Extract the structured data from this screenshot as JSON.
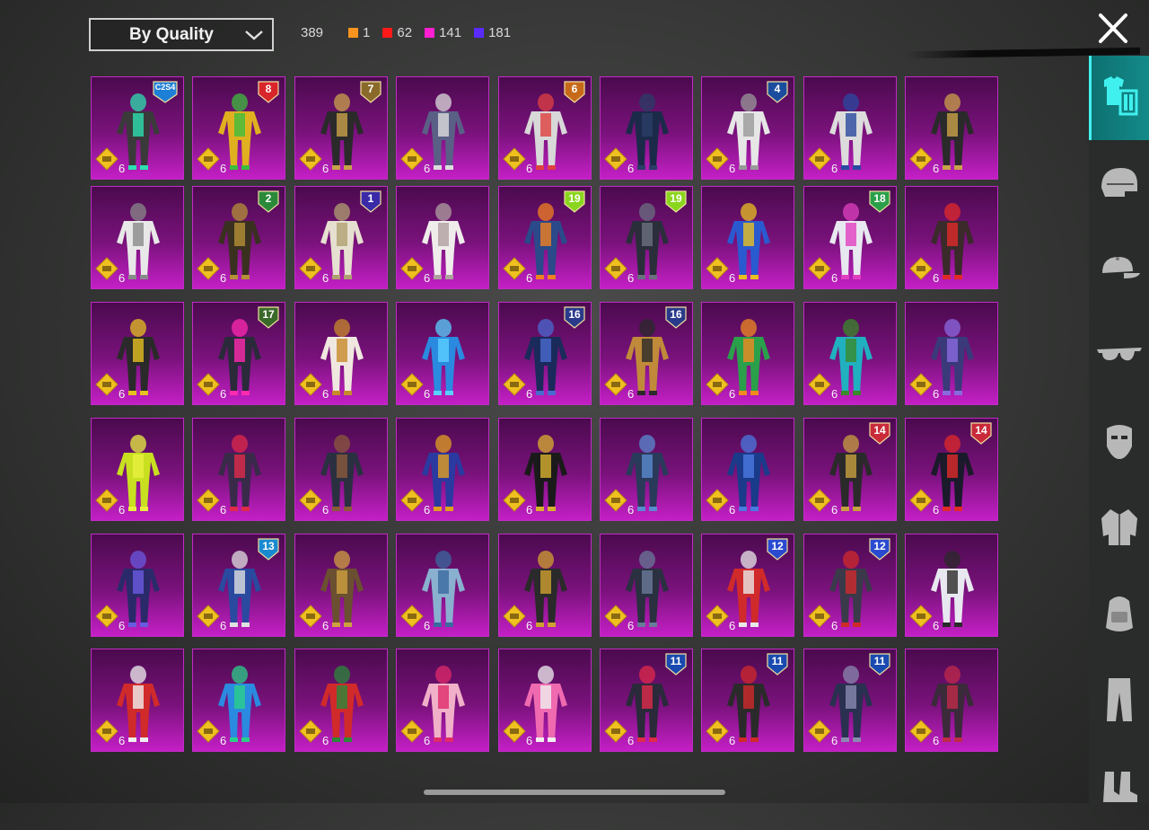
{
  "sort_dropdown": {
    "label": "By Quality"
  },
  "stats": {
    "total": "389",
    "counts": [
      {
        "value": "1",
        "color": "#f7931e"
      },
      {
        "value": "62",
        "color": "#ff1a1a"
      },
      {
        "value": "141",
        "color": "#ff1fd0"
      },
      {
        "value": "181",
        "color": "#5a2bff"
      }
    ]
  },
  "sidebar": {
    "categories": [
      {
        "icon": "outfit-icon",
        "active": true
      },
      {
        "icon": "helmet-icon",
        "active": false
      },
      {
        "icon": "cap-icon",
        "active": false
      },
      {
        "icon": "glasses-icon",
        "active": false
      },
      {
        "icon": "mask-icon",
        "active": false
      },
      {
        "icon": "jacket-icon",
        "active": false
      },
      {
        "icon": "backpack-icon",
        "active": false
      },
      {
        "icon": "pants-icon",
        "active": false
      },
      {
        "icon": "shoes-icon",
        "active": false
      }
    ]
  },
  "items": [
    {
      "qty": "6",
      "badge": "C2S4",
      "badge_color": "#1e7fd6",
      "suit": "#3a3a3a",
      "accent": "#2de0b0"
    },
    {
      "qty": "6",
      "badge": "8",
      "badge_color": "#d8252a",
      "suit": "#e0b020",
      "accent": "#3dbd3d"
    },
    {
      "qty": "6",
      "badge": "7",
      "badge_color": "#8a6a2a",
      "suit": "#2a2a2a",
      "accent": "#c9a14a"
    },
    {
      "qty": "6",
      "badge": "",
      "badge_color": "",
      "suit": "#5a5f86",
      "accent": "#dcdcdc"
    },
    {
      "qty": "6",
      "badge": "6",
      "badge_color": "#c66a1a",
      "suit": "#d8d8d8",
      "accent": "#e04040"
    },
    {
      "qty": "6",
      "badge": "",
      "badge_color": "",
      "suit": "#1c2a4a",
      "accent": "#2a3d66"
    },
    {
      "qty": "6",
      "badge": "4",
      "badge_color": "#1b4d9e",
      "suit": "#e6e6e6",
      "accent": "#9a9a9a"
    },
    {
      "qty": "6",
      "badge": "",
      "badge_color": "",
      "suit": "#dcdcdc",
      "accent": "#2a4aa0"
    },
    {
      "qty": "6",
      "badge": "",
      "badge_color": "",
      "suit": "#2a2a2a",
      "accent": "#caa24a"
    },
    {
      "qty": "6",
      "badge": "",
      "badge_color": "",
      "suit": "#e8e8e8",
      "accent": "#8a8a8a"
    },
    {
      "qty": "6",
      "badge": "2",
      "badge_color": "#2a8a3a",
      "suit": "#3a3020",
      "accent": "#b49036"
    },
    {
      "qty": "6",
      "badge": "1",
      "badge_color": "#3a2aa8",
      "suit": "#e6e0d0",
      "accent": "#b0a070"
    },
    {
      "qty": "6",
      "badge": "",
      "badge_color": "",
      "suit": "#f0ecec",
      "accent": "#b0a0a0"
    },
    {
      "qty": "6",
      "badge": "19",
      "badge_color": "#8ad61e",
      "suit": "#2a4a8a",
      "accent": "#f08020"
    },
    {
      "qty": "6",
      "badge": "19",
      "badge_color": "#8ad61e",
      "suit": "#2a2e3a",
      "accent": "#6a7080"
    },
    {
      "qty": "6",
      "badge": "",
      "badge_color": "",
      "suit": "#2a5ad0",
      "accent": "#e8c020"
    },
    {
      "qty": "6",
      "badge": "18",
      "badge_color": "#2aa04a",
      "suit": "#e8e8f0",
      "accent": "#e040c0"
    },
    {
      "qty": "6",
      "badge": "",
      "badge_color": "",
      "suit": "#3a2a2a",
      "accent": "#e02a2a"
    },
    {
      "qty": "6",
      "badge": "",
      "badge_color": "",
      "suit": "#2a2a2a",
      "accent": "#e6c020"
    },
    {
      "qty": "6",
      "badge": "17",
      "badge_color": "#3a6a2a",
      "suit": "#2a2a3a",
      "accent": "#ff2ab0"
    },
    {
      "qty": "6",
      "badge": "",
      "badge_color": "",
      "suit": "#f0e8e0",
      "accent": "#c88a2a"
    },
    {
      "qty": "6",
      "badge": "",
      "badge_color": "",
      "suit": "#2a8ae0",
      "accent": "#5ad0ff"
    },
    {
      "qty": "6",
      "badge": "16",
      "badge_color": "#2a3a8a",
      "suit": "#1a2a5a",
      "accent": "#4a6ad0"
    },
    {
      "qty": "6",
      "badge": "16",
      "badge_color": "#2a3a8a",
      "suit": "#c08a3a",
      "accent": "#2a2a2a"
    },
    {
      "qty": "6",
      "badge": "",
      "badge_color": "",
      "suit": "#2aa04a",
      "accent": "#f08a20"
    },
    {
      "qty": "6",
      "badge": "",
      "badge_color": "",
      "suit": "#20b0c0",
      "accent": "#3a8a2a"
    },
    {
      "qty": "6",
      "badge": "",
      "badge_color": "",
      "suit": "#3a3a7a",
      "accent": "#8a6ae0"
    },
    {
      "qty": "6",
      "badge": "",
      "badge_color": "",
      "suit": "#c8e020",
      "accent": "#e8f040"
    },
    {
      "qty": "6",
      "badge": "",
      "badge_color": "",
      "suit": "#3a2a4a",
      "accent": "#e02a4a"
    },
    {
      "qty": "6",
      "badge": "",
      "badge_color": "",
      "suit": "#2a3040",
      "accent": "#8a5a3a"
    },
    {
      "qty": "6",
      "badge": "",
      "badge_color": "",
      "suit": "#2a3aa0",
      "accent": "#e0a020"
    },
    {
      "qty": "6",
      "badge": "",
      "badge_color": "",
      "suit": "#1a1a1a",
      "accent": "#d8b030"
    },
    {
      "qty": "6",
      "badge": "",
      "badge_color": "",
      "suit": "#2a3a5a",
      "accent": "#5a8ad0"
    },
    {
      "qty": "6",
      "badge": "",
      "badge_color": "",
      "suit": "#1a3a8a",
      "accent": "#4a7ae0"
    },
    {
      "qty": "6",
      "badge": "14",
      "badge_color": "#c82a3a",
      "suit": "#2a2a2a",
      "accent": "#c8a040"
    },
    {
      "qty": "6",
      "badge": "14",
      "badge_color": "#c82a3a",
      "suit": "#1a1a2a",
      "accent": "#e02a2a"
    },
    {
      "qty": "6",
      "badge": "",
      "badge_color": "",
      "suit": "#2a2a6a",
      "accent": "#6a5ae0"
    },
    {
      "qty": "6",
      "badge": "13",
      "badge_color": "#1a8ad0",
      "suit": "#2a4aa0",
      "accent": "#e0e0e0"
    },
    {
      "qty": "6",
      "badge": "",
      "badge_color": "",
      "suit": "#6a5030",
      "accent": "#d0a040"
    },
    {
      "qty": "6",
      "badge": "",
      "badge_color": "",
      "suit": "#8ab0d0",
      "accent": "#3a6aa0"
    },
    {
      "qty": "6",
      "badge": "",
      "badge_color": "",
      "suit": "#2a2a2a",
      "accent": "#d0a030"
    },
    {
      "qty": "6",
      "badge": "",
      "badge_color": "",
      "suit": "#2a3040",
      "accent": "#6a7a9a"
    },
    {
      "qty": "6",
      "badge": "12",
      "badge_color": "#2a4ad0",
      "suit": "#d02a2a",
      "accent": "#e8e8e8"
    },
    {
      "qty": "6",
      "badge": "12",
      "badge_color": "#2a4ad0",
      "suit": "#3a3a4a",
      "accent": "#d02a2a"
    },
    {
      "qty": "6",
      "badge": "",
      "badge_color": "",
      "suit": "#e8e8f0",
      "accent": "#2a2a2a"
    },
    {
      "qty": "6",
      "badge": "",
      "badge_color": "",
      "suit": "#d02a2a",
      "accent": "#f0f0f0"
    },
    {
      "qty": "6",
      "badge": "",
      "badge_color": "",
      "suit": "#2a8ae0",
      "accent": "#2ad08a"
    },
    {
      "qty": "6",
      "badge": "",
      "badge_color": "",
      "suit": "#d02a2a",
      "accent": "#2a8a3a"
    },
    {
      "qty": "6",
      "badge": "",
      "badge_color": "",
      "suit": "#f0b0c8",
      "accent": "#e02a6a"
    },
    {
      "qty": "6",
      "badge": "",
      "badge_color": "",
      "suit": "#f06ab0",
      "accent": "#f0f0f0"
    },
    {
      "qty": "6",
      "badge": "11",
      "badge_color": "#1a4ab0",
      "suit": "#2a2a3a",
      "accent": "#e02a4a"
    },
    {
      "qty": "6",
      "badge": "11",
      "badge_color": "#1a4ab0",
      "suit": "#2a2a2a",
      "accent": "#d02a2a"
    },
    {
      "qty": "6",
      "badge": "11",
      "badge_color": "#1a4ab0",
      "suit": "#2a3050",
      "accent": "#8a8ab0"
    },
    {
      "qty": "6",
      "badge": "",
      "badge_color": "",
      "suit": "#3a2a3a",
      "accent": "#c02a4a"
    }
  ]
}
